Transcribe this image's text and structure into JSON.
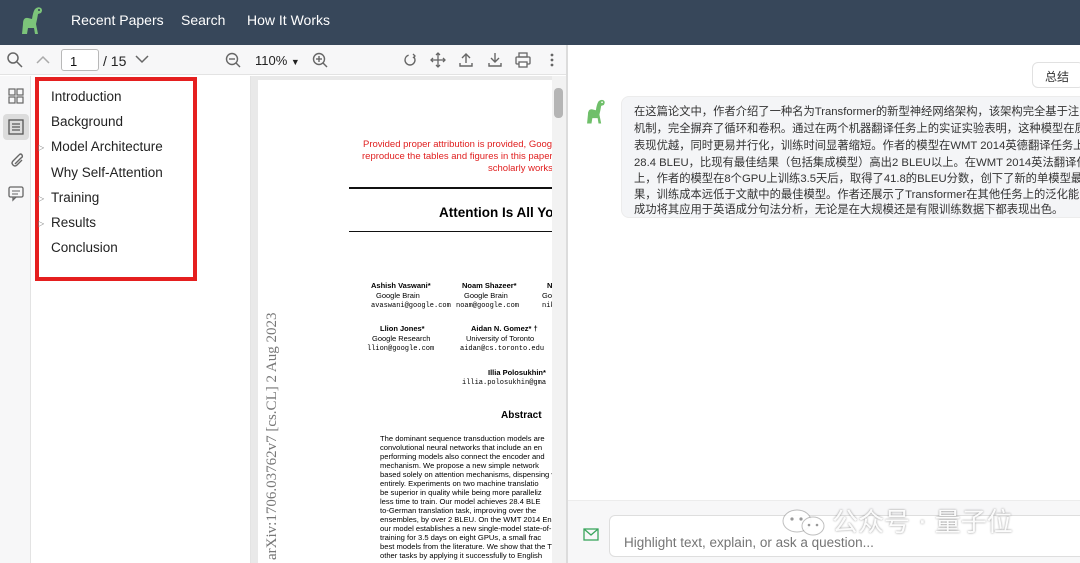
{
  "nav": {
    "logo_icon": "dinosaur-logo-icon",
    "links": [
      "Recent Papers",
      "Search",
      "How It Works"
    ]
  },
  "pdf_toolbar": {
    "page_current": "1",
    "page_total": "/ 15",
    "zoom": "110%"
  },
  "outline": {
    "items": [
      {
        "label": "Introduction",
        "expandable": false
      },
      {
        "label": "Background",
        "expandable": false
      },
      {
        "label": "Model Architecture",
        "expandable": true
      },
      {
        "label": "Why Self-Attention",
        "expandable": false
      },
      {
        "label": "Training",
        "expandable": true
      },
      {
        "label": "Results",
        "expandable": true
      },
      {
        "label": "Conclusion",
        "expandable": false
      }
    ],
    "highlight_color": "#e51f1f"
  },
  "paper": {
    "attribution": [
      "Provided proper attribution is provided, Goog",
      "reproduce the tables and figures in this paper s",
      "scholarly works"
    ],
    "title": "Attention Is All Yo",
    "arxiv_id": "arXiv:1706.03762v7  [cs.CL]  2 Aug 2023",
    "authors": [
      {
        "name": "Ashish Vaswani*",
        "affil": "Google Brain",
        "email": "avaswani@google.com"
      },
      {
        "name": "Noam Shazeer*",
        "affil": "Google Brain",
        "email": "noam@google.com"
      },
      {
        "name": "N",
        "affil": "Go",
        "email": "niki"
      },
      {
        "name": "Llion Jones*",
        "affil": "Google Research",
        "email": "llion@google.com"
      },
      {
        "name": "Aidan N. Gomez* †",
        "affil": "University of Toronto",
        "email": "aidan@cs.toronto.edu"
      },
      {
        "name": "Illia Polosukhin*",
        "affil": "",
        "email": "illia.polosukhin@gma"
      }
    ],
    "abstract_heading": "Abstract",
    "abstract_lines": [
      "The dominant sequence transduction models are",
      "convolutional neural networks that include an en",
      "performing models also connect the encoder and",
      "mechanism.  We propose a new simple network",
      "based solely on attention mechanisms, dispensing v",
      "entirely.  Experiments on two machine translatio",
      "be superior in quality while being more paralleliz",
      "less time to train.  Our model achieves 28.4 BLE",
      "to-German translation task, improving over the",
      "ensembles, by over 2 BLEU. On the WMT 2014 En",
      "our model establishes a new single-model state-of-",
      "training for 3.5 days on eight GPUs, a small frac",
      "best models from the literature. We show that the T",
      "other tasks by applying it successfully to English"
    ]
  },
  "chat": {
    "summary_button": "总结",
    "message_lines": [
      "在这篇论文中，作者介绍了一种名为Transformer的新型神经网络架构，该架构完全基于注意",
      "机制，完全摒弃了循环和卷积。通过在两个机器翻译任务上的实证实验表明，这种模型在质量",
      "表现优越，同时更易并行化，训练时间显著缩短。作者的模型在WMT 2014英德翻译任务上",
      "28.4 BLEU，比现有最佳结果（包括集成模型）高出2 BLEU以上。在WMT 2014英法翻译任",
      "上，作者的模型在8个GPU上训练3.5天后，取得了41.8的BLEU分数，创下了新的单模型最优",
      "果，训练成本远低于文献中的最佳模型。作者还展示了Transformer在其他任务上的泛化能力",
      "成功将其应用于英语成分句法分析，无论是在大规模还是有限训练数据下都表现出色。"
    ],
    "input_placeholder": "Highlight text, explain, or ask a question...",
    "watermark": "公众号 · 量子位"
  }
}
